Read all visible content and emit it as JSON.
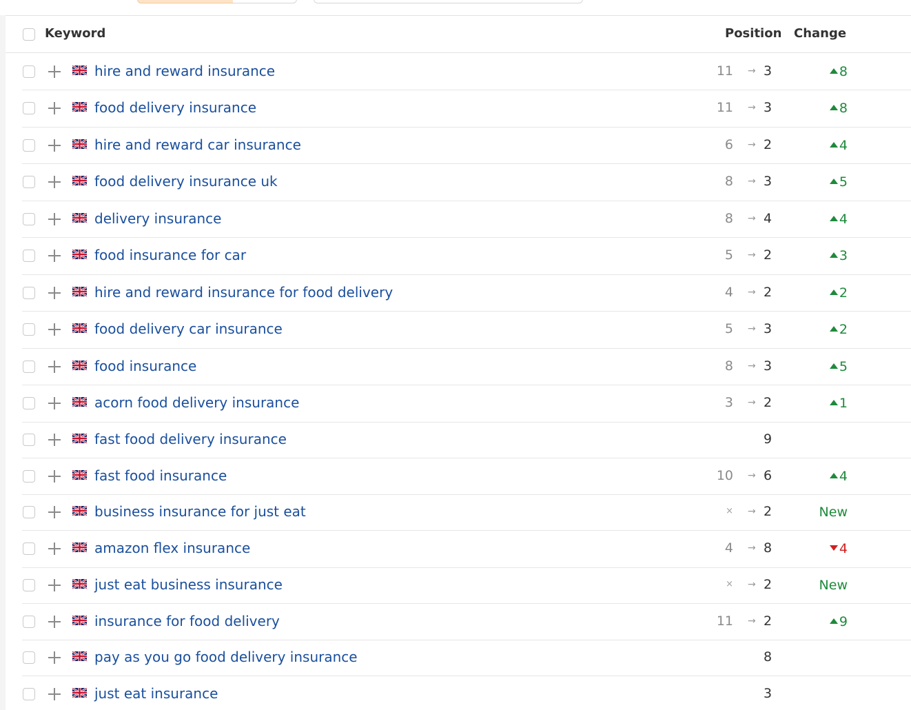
{
  "header": {
    "keyword": "Keyword",
    "position": "Position",
    "change": "Change"
  },
  "colors": {
    "link": "#1a4f9c",
    "up": "#1e8a3c",
    "down": "#d11f1f",
    "toolbar_active": "#fde4c8"
  },
  "icons": {
    "flag": "uk-flag-icon",
    "add": "plus-icon"
  },
  "rows": [
    {
      "keyword": "hire and reward insurance",
      "old": "11",
      "arrow": "→",
      "new": "3",
      "dir": "up",
      "change": "8"
    },
    {
      "keyword": "food delivery insurance",
      "old": "11",
      "arrow": "→",
      "new": "3",
      "dir": "up",
      "change": "8"
    },
    {
      "keyword": "hire and reward car insurance",
      "old": "6",
      "arrow": "→",
      "new": "2",
      "dir": "up",
      "change": "4"
    },
    {
      "keyword": "food delivery insurance uk",
      "old": "8",
      "arrow": "→",
      "new": "3",
      "dir": "up",
      "change": "5"
    },
    {
      "keyword": "delivery insurance",
      "old": "8",
      "arrow": "→",
      "new": "4",
      "dir": "up",
      "change": "4"
    },
    {
      "keyword": "food insurance for car",
      "old": "5",
      "arrow": "→",
      "new": "2",
      "dir": "up",
      "change": "3"
    },
    {
      "keyword": "hire and reward insurance for food delivery",
      "old": "4",
      "arrow": "→",
      "new": "2",
      "dir": "up",
      "change": "2"
    },
    {
      "keyword": "food delivery car insurance",
      "old": "5",
      "arrow": "→",
      "new": "3",
      "dir": "up",
      "change": "2"
    },
    {
      "keyword": "food insurance",
      "old": "8",
      "arrow": "→",
      "new": "3",
      "dir": "up",
      "change": "5"
    },
    {
      "keyword": "acorn food delivery insurance",
      "old": "3",
      "arrow": "→",
      "new": "2",
      "dir": "up",
      "change": "1"
    },
    {
      "keyword": "fast food delivery insurance",
      "old": "",
      "arrow": "",
      "new": "9",
      "dir": "none",
      "change": ""
    },
    {
      "keyword": "fast food insurance",
      "old": "10",
      "arrow": "→",
      "new": "6",
      "dir": "up",
      "change": "4"
    },
    {
      "keyword": "business insurance for just eat",
      "old": "×",
      "arrow": "→",
      "new": "2",
      "dir": "new",
      "change": "New"
    },
    {
      "keyword": "amazon flex insurance",
      "old": "4",
      "arrow": "→",
      "new": "8",
      "dir": "down",
      "change": "4"
    },
    {
      "keyword": "just eat business insurance",
      "old": "×",
      "arrow": "→",
      "new": "2",
      "dir": "new",
      "change": "New"
    },
    {
      "keyword": "insurance for food delivery",
      "old": "11",
      "arrow": "→",
      "new": "2",
      "dir": "up",
      "change": "9"
    },
    {
      "keyword": "pay as you go food delivery insurance",
      "old": "",
      "arrow": "",
      "new": "8",
      "dir": "none",
      "change": ""
    },
    {
      "keyword": "just eat insurance",
      "old": "",
      "arrow": "",
      "new": "3",
      "dir": "none",
      "change": ""
    }
  ]
}
